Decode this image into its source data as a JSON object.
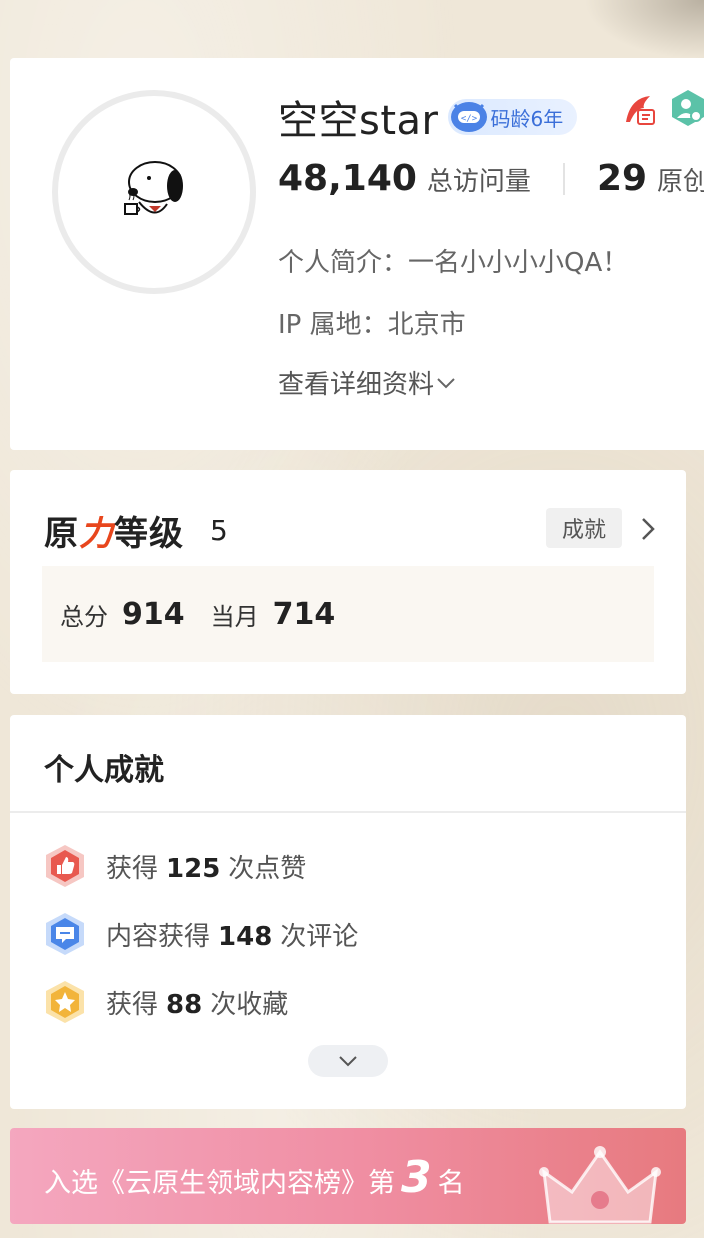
{
  "profile": {
    "username": "空空star",
    "code_age_badge": "码龄6年",
    "visits": {
      "value": "48,140",
      "label": "总访问量"
    },
    "originals": {
      "value": "29",
      "label": "原创"
    },
    "intro": "个人简介：一名小小小小QA！",
    "ip_location": "IP 属地：北京市",
    "details_link": "查看详细资料"
  },
  "level": {
    "title_part1": "原",
    "title_accent": "力",
    "title_part2": "等级",
    "value": "5",
    "achievements_button": "成就",
    "total_label": "总分",
    "total_value": "914",
    "month_label": "当月",
    "month_value": "714"
  },
  "achievements": {
    "title": "个人成就",
    "items": [
      {
        "pre": "获得",
        "num": "125",
        "post": "次点赞",
        "icon": "thumbs-up-icon",
        "color": "#e8594f"
      },
      {
        "pre": "内容获得",
        "num": "148",
        "post": "次评论",
        "icon": "comment-icon",
        "color": "#4a86e8"
      },
      {
        "pre": "获得",
        "num": "88",
        "post": "次收藏",
        "icon": "star-icon",
        "color": "#f2b43a"
      }
    ]
  },
  "ranking": {
    "prefix": "入选《云原生领域内容榜》第",
    "rank": "3",
    "suffix": "名"
  }
}
